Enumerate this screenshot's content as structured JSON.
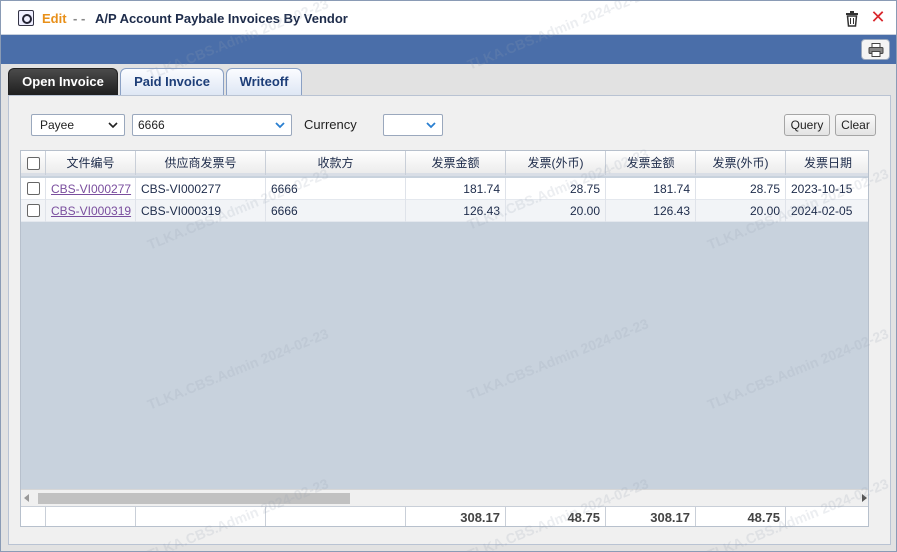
{
  "window": {
    "title_edit": "Edit",
    "title_sep": "- -",
    "title": "A/P Account Paybale Invoices By Vendor"
  },
  "tabs": [
    {
      "label": "Open Invoice",
      "active": true
    },
    {
      "label": "Paid Invoice",
      "active": false
    },
    {
      "label": "Writeoff",
      "active": false
    }
  ],
  "filters": {
    "field_select": "Payee",
    "value_select": "6666",
    "currency_label": "Currency",
    "currency_select": "",
    "query_label": "Query",
    "clear_label": "Clear"
  },
  "table": {
    "columns": [
      "文件编号",
      "供应商发票号",
      "收款方",
      "发票金额",
      "发票(外币)",
      "发票金额",
      "发票(外币)",
      "发票日期"
    ],
    "rows": [
      [
        "CBS-VI000277",
        "CBS-VI000277",
        "6666",
        "181.74",
        "28.75",
        "181.74",
        "28.75",
        "2023-10-15"
      ],
      [
        "CBS-VI000319",
        "CBS-VI000319",
        "6666",
        "126.43",
        "20.00",
        "126.43",
        "20.00",
        "2024-02-05"
      ]
    ],
    "totals": [
      "",
      "",
      "",
      "308.17",
      "48.75",
      "308.17",
      "48.75",
      ""
    ]
  },
  "watermark": "TLKA.CBS.Admin 2024-02-23",
  "colors": {
    "header_blue": "#4a6ea9",
    "title_orange": "#e8901a",
    "link_purple": "#7a4e9e",
    "close_red": "#d9262b"
  }
}
